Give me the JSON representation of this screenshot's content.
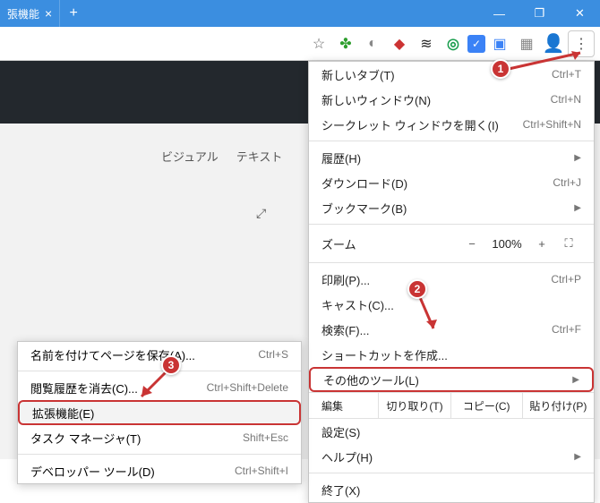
{
  "title": "張機能",
  "win": {
    "min": "—",
    "max": "❐",
    "close": "✕"
  },
  "subtabs": {
    "visual": "ビジュアル",
    "text": "テキスト"
  },
  "menu": {
    "new_tab": "新しいタブ(T)",
    "new_tab_sc": "Ctrl+T",
    "new_window": "新しいウィンドウ(N)",
    "new_window_sc": "Ctrl+N",
    "incognito": "シークレット ウィンドウを開く(I)",
    "incognito_sc": "Ctrl+Shift+N",
    "history": "履歴(H)",
    "downloads": "ダウンロード(D)",
    "downloads_sc": "Ctrl+J",
    "bookmarks": "ブックマーク(B)",
    "zoom": "ズーム",
    "zoom_pct": "100%",
    "zoom_minus": "−",
    "zoom_plus": "+",
    "print": "印刷(P)...",
    "print_sc": "Ctrl+P",
    "cast": "キャスト(C)...",
    "find": "検索(F)...",
    "find_sc": "Ctrl+F",
    "shortcut": "ショートカットを作成...",
    "more_tools": "その他のツール(L)",
    "edit": "編集",
    "cut": "切り取り(T)",
    "copy": "コピー(C)",
    "paste": "貼り付け(P)",
    "settings": "設定(S)",
    "help": "ヘルプ(H)",
    "exit": "終了(X)"
  },
  "submenu": {
    "save_as": "名前を付けてページを保存(A)...",
    "save_as_sc": "Ctrl+S",
    "clear": "閲覧履歴を消去(C)...",
    "clear_sc": "Ctrl+Shift+Delete",
    "extensions": "拡張機能(E)",
    "task": "タスク マネージャ(T)",
    "task_sc": "Shift+Esc",
    "dev": "デベロッパー ツール(D)",
    "dev_sc": "Ctrl+Shift+I"
  },
  "callouts": {
    "c1": "1",
    "c2": "2",
    "c3": "3"
  }
}
